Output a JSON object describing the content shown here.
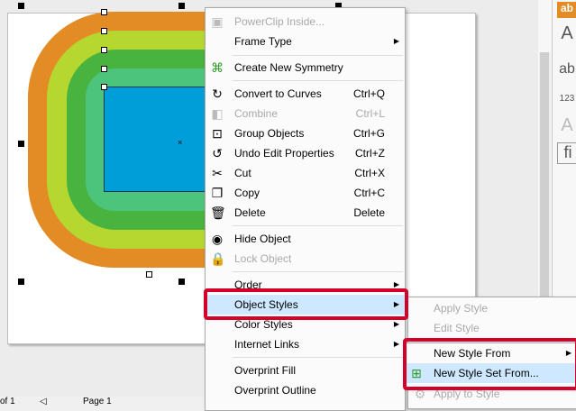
{
  "colors": {
    "orange": "#e38c25",
    "yellowgreen": "#b5d72f",
    "green": "#48b33e",
    "lightgreen": "#4cc47c",
    "blue": "#009ed8",
    "highlight": "#cde8ff",
    "callout": "#d4002a"
  },
  "status": {
    "page_of": "of 1",
    "page_tab": "Page 1"
  },
  "context_menu": {
    "items": [
      {
        "label": "PowerClip Inside...",
        "shortcut": "",
        "icon": "powerclip-icon",
        "disabled": true
      },
      {
        "label": "Frame Type",
        "shortcut": "",
        "submenu": true
      },
      {
        "label": "Create New Symmetry",
        "shortcut": "",
        "icon": "symmetry-icon"
      },
      {
        "label": "Convert to Curves",
        "shortcut": "Ctrl+Q",
        "icon": "convert-curves-icon"
      },
      {
        "label": "Combine",
        "shortcut": "Ctrl+L",
        "icon": "combine-icon",
        "disabled": true
      },
      {
        "label": "Group Objects",
        "shortcut": "Ctrl+G",
        "icon": "group-icon"
      },
      {
        "label": "Undo Edit Properties",
        "shortcut": "Ctrl+Z",
        "icon": "undo-icon"
      },
      {
        "label": "Cut",
        "shortcut": "Ctrl+X",
        "icon": "cut-icon"
      },
      {
        "label": "Copy",
        "shortcut": "Ctrl+C",
        "icon": "copy-icon"
      },
      {
        "label": "Delete",
        "shortcut": "Delete",
        "icon": "trash-icon"
      },
      {
        "label": "Hide Object",
        "shortcut": "",
        "icon": "hide-eye-icon"
      },
      {
        "label": "Lock Object",
        "shortcut": "",
        "icon": "lock-icon",
        "disabled": true
      },
      {
        "label": "Order",
        "shortcut": "",
        "submenu": true
      },
      {
        "label": "Object Styles",
        "shortcut": "",
        "submenu": true
      },
      {
        "label": "Color Styles",
        "shortcut": "",
        "submenu": true
      },
      {
        "label": "Internet Links",
        "shortcut": "",
        "submenu": true
      },
      {
        "label": "Overprint Fill",
        "shortcut": ""
      },
      {
        "label": "Overprint Outline",
        "shortcut": ""
      }
    ]
  },
  "object_styles_menu": {
    "items": [
      {
        "label": "Apply Style",
        "disabled": true
      },
      {
        "label": "Edit Style",
        "disabled": true
      },
      {
        "label": "Apply to Style",
        "disabled": true
      }
    ]
  },
  "new_style_menu": {
    "items": [
      {
        "label": "New Style From",
        "submenu": true
      },
      {
        "label": "New Style Set From...",
        "icon": "new-style-set-icon"
      }
    ]
  },
  "right_panel": {
    "glyph_a": "A",
    "glyph_ab": "ab",
    "glyph_123": "123",
    "glyph_fi": "fi",
    "label_ab": "ab"
  }
}
